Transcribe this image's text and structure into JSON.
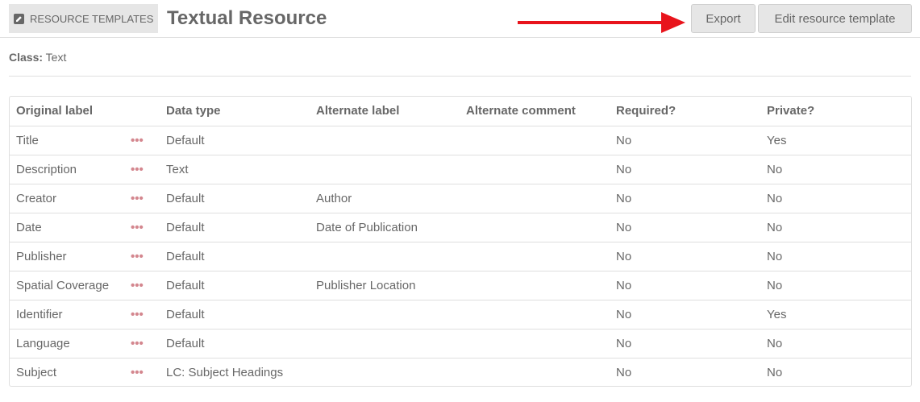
{
  "header": {
    "section_label": "RESOURCE TEMPLATES",
    "section_icon": "edit-square-icon",
    "title": "Textual Resource",
    "export_label": "Export",
    "edit_label": "Edit resource template",
    "arrow_color": "#e8141c"
  },
  "class_info": {
    "label": "Class:",
    "value": "Text"
  },
  "table": {
    "columns": [
      "Original label",
      "",
      "Data type",
      "Alternate label",
      "Alternate comment",
      "Required?",
      "Private?"
    ],
    "actions_icon": "ellipsis-icon",
    "rows": [
      {
        "original": "Title",
        "data_type": "Default",
        "alt_label": "",
        "alt_comment": "",
        "required": "No",
        "private": "Yes"
      },
      {
        "original": "Description",
        "data_type": "Text",
        "alt_label": "",
        "alt_comment": "",
        "required": "No",
        "private": "No"
      },
      {
        "original": "Creator",
        "data_type": "Default",
        "alt_label": "Author",
        "alt_comment": "",
        "required": "No",
        "private": "No"
      },
      {
        "original": "Date",
        "data_type": "Default",
        "alt_label": "Date of Publication",
        "alt_comment": "",
        "required": "No",
        "private": "No"
      },
      {
        "original": "Publisher",
        "data_type": "Default",
        "alt_label": "",
        "alt_comment": "",
        "required": "No",
        "private": "No"
      },
      {
        "original": "Spatial Coverage",
        "data_type": "Default",
        "alt_label": "Publisher Location",
        "alt_comment": "",
        "required": "No",
        "private": "No"
      },
      {
        "original": "Identifier",
        "data_type": "Default",
        "alt_label": "",
        "alt_comment": "",
        "required": "No",
        "private": "Yes"
      },
      {
        "original": "Language",
        "data_type": "Default",
        "alt_label": "",
        "alt_comment": "",
        "required": "No",
        "private": "No"
      },
      {
        "original": "Subject",
        "data_type": "LC: Subject Headings",
        "alt_label": "",
        "alt_comment": "",
        "required": "No",
        "private": "No"
      }
    ]
  }
}
